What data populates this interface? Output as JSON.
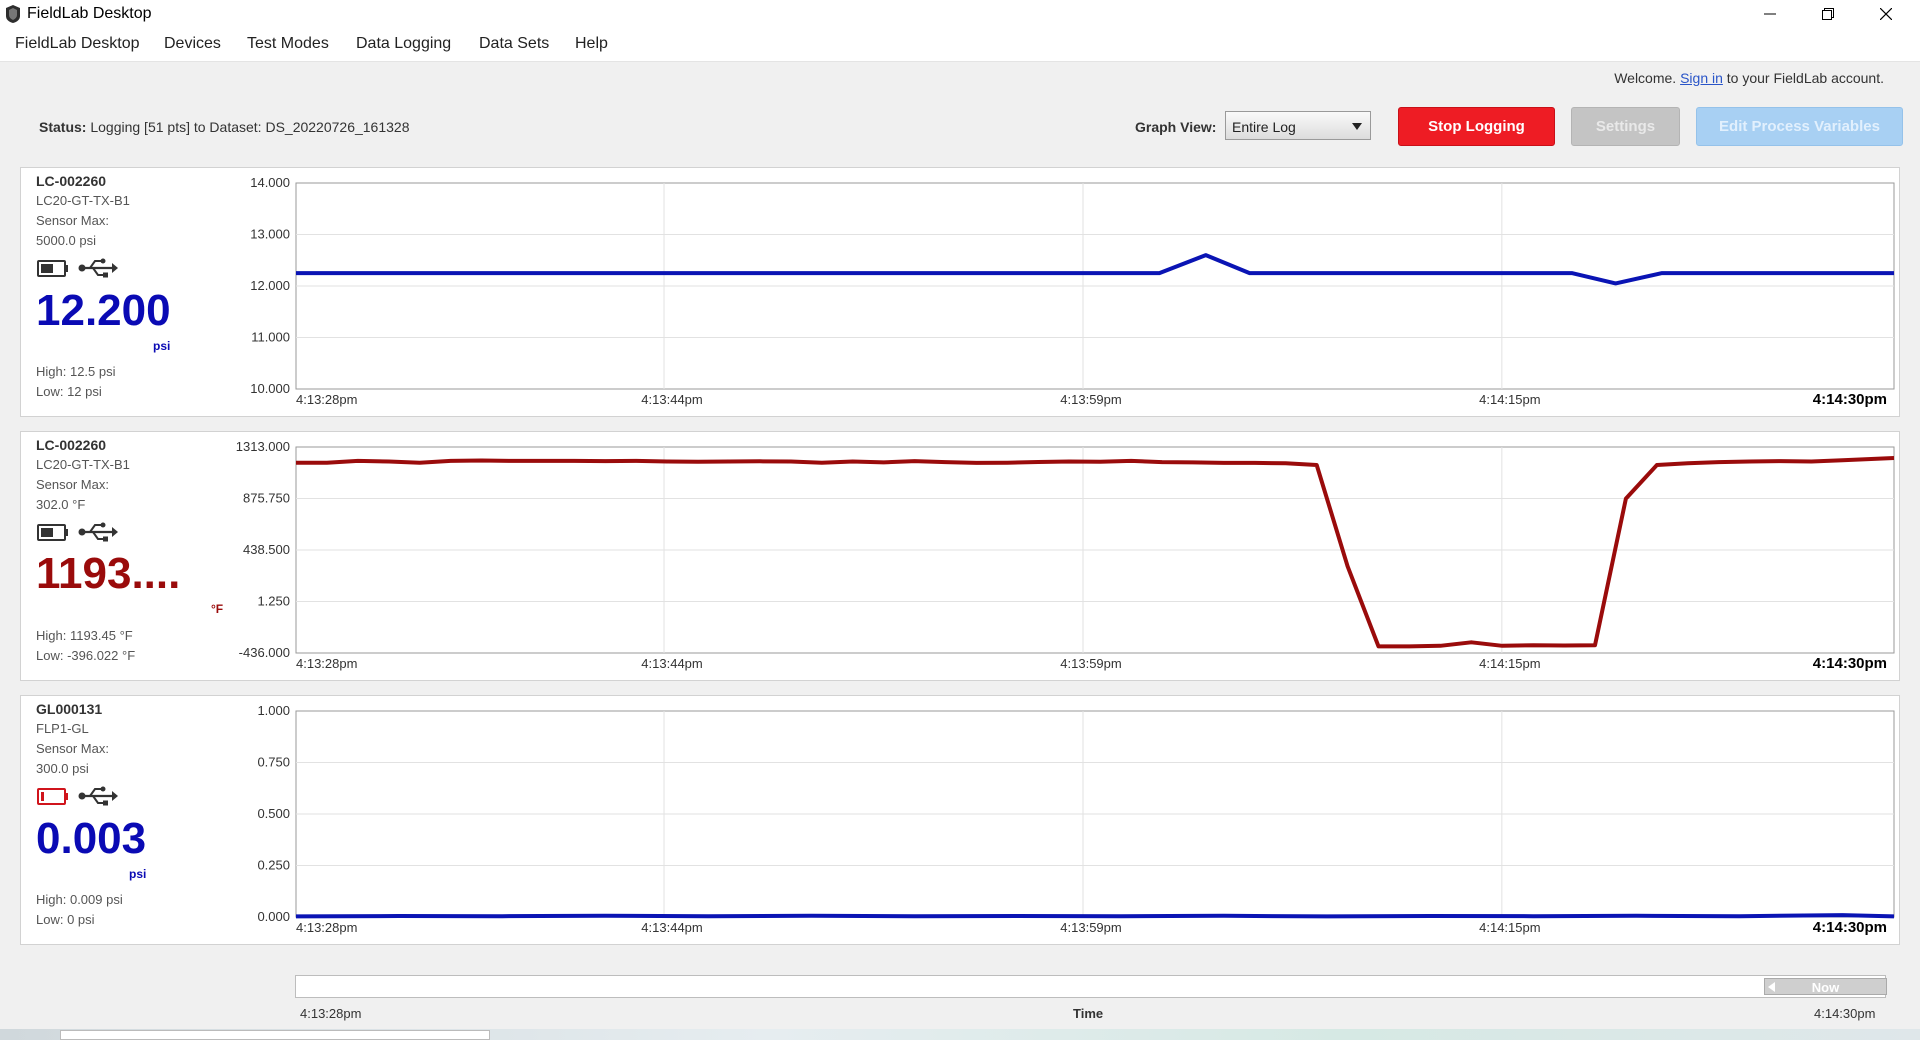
{
  "window": {
    "title": "FieldLab Desktop"
  },
  "menu": [
    "FieldLab Desktop",
    "Devices",
    "Test Modes",
    "Data Logging",
    "Data Sets",
    "Help"
  ],
  "account": {
    "prefix": "Welcome.",
    "link": "Sign in",
    "suffix": "to your FieldLab account."
  },
  "status": {
    "label": "Status:",
    "text": "Logging [51 pts] to Dataset: DS_20220726_161328"
  },
  "graph_view": {
    "label": "Graph View:",
    "value": "Entire Log"
  },
  "buttons": {
    "stop": "Stop Logging",
    "settings": "Settings",
    "edit": "Edit Process Variables"
  },
  "panels": [
    {
      "device_id": "LC-002260",
      "model": "LC20-GT-TX-B1",
      "sensor_max_label": "Sensor Max:",
      "sensor_max": "5000.0 psi",
      "reading": "12.200",
      "unit": "psi",
      "high": "High: 12.5 psi",
      "low": "Low: 12 psi",
      "battery_status": "normal",
      "reading_color": "#0a0ab4",
      "line_color": "#0a14b4"
    },
    {
      "device_id": "LC-002260",
      "model": "LC20-GT-TX-B1",
      "sensor_max_label": "Sensor Max:",
      "sensor_max": "302.0 °F",
      "reading": "1193....",
      "unit": "°F",
      "high": "High: 1193.45 °F",
      "low": "Low: -396.022 °F",
      "battery_status": "normal",
      "reading_color": "#9a0b0b",
      "line_color": "#9a0b0b"
    },
    {
      "device_id": "GL000131",
      "model": "FLP1-GL",
      "sensor_max_label": "Sensor Max:",
      "sensor_max": "300.0 psi",
      "reading": "0.003",
      "unit": "psi",
      "high": "High: 0.009 psi",
      "low": "Low: 0 psi",
      "battery_status": "low",
      "reading_color": "#0a0ab4",
      "line_color": "#0a14b4"
    }
  ],
  "chart_data": [
    {
      "type": "line",
      "x_ticks": [
        "4:13:28pm",
        "4:13:44pm",
        "4:13:59pm",
        "4:14:15pm",
        "4:14:30pm"
      ],
      "y_ticks": [
        "14.000",
        "13.000",
        "12.000",
        "11.000",
        "10.000"
      ],
      "ylim": [
        10,
        14
      ],
      "grid": true,
      "x_seconds_span": 62,
      "series": [
        {
          "values": [
            [
              0,
              12.25
            ],
            [
              33.5,
              12.25
            ],
            [
              35.3,
              12.6
            ],
            [
              37,
              12.25
            ],
            [
              49.5,
              12.25
            ],
            [
              51.2,
              12.05
            ],
            [
              53,
              12.25
            ],
            [
              62,
              12.25
            ]
          ]
        }
      ]
    },
    {
      "type": "line",
      "x_ticks": [
        "4:13:28pm",
        "4:13:44pm",
        "4:13:59pm",
        "4:14:15pm",
        "4:14:30pm"
      ],
      "y_ticks": [
        "1313.000",
        "875.750",
        "438.500",
        "1.250",
        "-436.000"
      ],
      "ylim": [
        -436,
        1313
      ],
      "grid": true,
      "x_seconds_span": 62,
      "series": [
        {
          "values": [
            [
              0,
              1180
            ],
            [
              1.2,
              1180
            ],
            [
              2.4,
              1195
            ],
            [
              3.6,
              1190
            ],
            [
              4.8,
              1180
            ],
            [
              6,
              1195
            ],
            [
              7.2,
              1198
            ],
            [
              8.4,
              1195
            ],
            [
              9.6,
              1195
            ],
            [
              10.8,
              1195
            ],
            [
              12,
              1193
            ],
            [
              13.2,
              1195
            ],
            [
              14.4,
              1190
            ],
            [
              15.6,
              1188
            ],
            [
              16.8,
              1190
            ],
            [
              18,
              1192
            ],
            [
              19.2,
              1190
            ],
            [
              20.4,
              1180
            ],
            [
              21.6,
              1190
            ],
            [
              22.8,
              1182
            ],
            [
              24,
              1193
            ],
            [
              25.2,
              1185
            ],
            [
              26.4,
              1178
            ],
            [
              27.6,
              1180
            ],
            [
              28.8,
              1186
            ],
            [
              30,
              1190
            ],
            [
              31.2,
              1188
            ],
            [
              32.4,
              1195
            ],
            [
              33.6,
              1185
            ],
            [
              34.8,
              1182
            ],
            [
              36,
              1178
            ],
            [
              37.2,
              1178
            ],
            [
              38.4,
              1175
            ],
            [
              39.6,
              1160
            ],
            [
              40.8,
              300
            ],
            [
              42,
              -380
            ],
            [
              43.2,
              -380
            ],
            [
              44.4,
              -375
            ],
            [
              45.6,
              -345
            ],
            [
              46.8,
              -375
            ],
            [
              48,
              -370
            ],
            [
              49.2,
              -372
            ],
            [
              50.4,
              -370
            ],
            [
              51.6,
              875
            ],
            [
              52.8,
              1160
            ],
            [
              54,
              1175
            ],
            [
              55.2,
              1185
            ],
            [
              56.4,
              1190
            ],
            [
              57.6,
              1193
            ],
            [
              58.8,
              1190
            ],
            [
              60,
              1200
            ],
            [
              62,
              1220
            ]
          ]
        }
      ]
    },
    {
      "type": "line",
      "x_ticks": [
        "4:13:28pm",
        "4:13:44pm",
        "4:13:59pm",
        "4:14:15pm",
        "4:14:30pm"
      ],
      "y_ticks": [
        "1.000",
        "0.750",
        "0.500",
        "0.250",
        "0.000"
      ],
      "ylim": [
        0,
        1
      ],
      "grid": true,
      "x_seconds_span": 62,
      "series": [
        {
          "values": [
            [
              0,
              0.003
            ],
            [
              4,
              0.005
            ],
            [
              8,
              0.004
            ],
            [
              12,
              0.006
            ],
            [
              16,
              0.004
            ],
            [
              20,
              0.006
            ],
            [
              24,
              0.004
            ],
            [
              28,
              0.005
            ],
            [
              32,
              0.004
            ],
            [
              36,
              0.006
            ],
            [
              40,
              0.003
            ],
            [
              44,
              0.005
            ],
            [
              48,
              0.004
            ],
            [
              52,
              0.006
            ],
            [
              56,
              0.004
            ],
            [
              60,
              0.009
            ],
            [
              62,
              0.003
            ]
          ]
        }
      ]
    }
  ],
  "time_range": {
    "start": "4:13:28pm",
    "label": "Time",
    "end": "4:14:30pm",
    "now_label": "Now"
  }
}
